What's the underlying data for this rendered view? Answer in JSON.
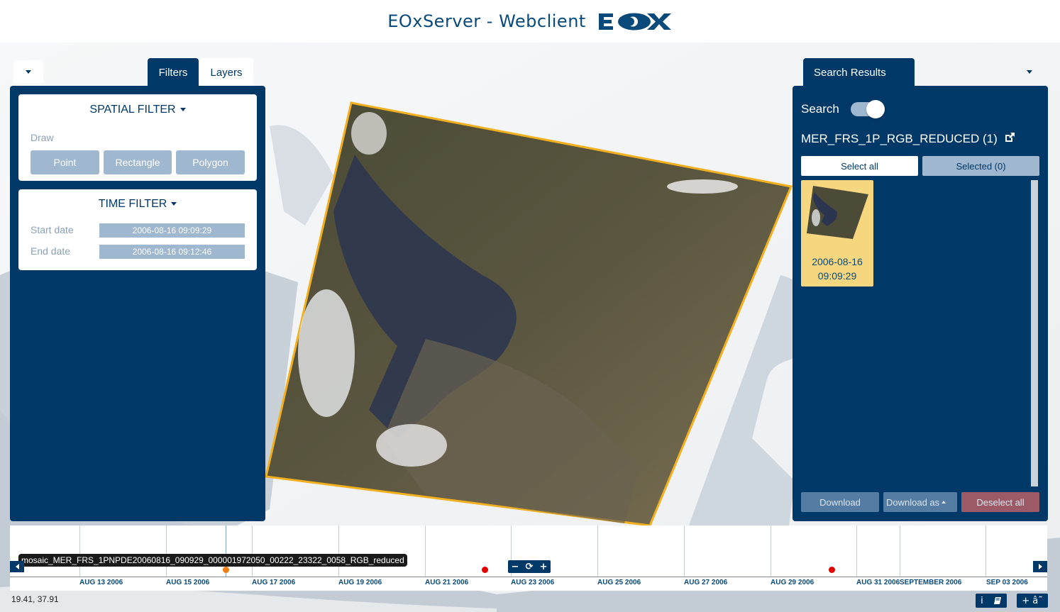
{
  "header": {
    "title": "EOxServer - Webclient",
    "logo_text": "EOX"
  },
  "left_panel": {
    "tabs": [
      {
        "label": "Filters",
        "active": true
      },
      {
        "label": "Layers",
        "active": false
      }
    ],
    "spatial_filter": {
      "title": "SPATIAL FILTER",
      "draw_label": "Draw",
      "buttons": [
        "Point",
        "Rectangle",
        "Polygon"
      ]
    },
    "time_filter": {
      "title": "TIME FILTER",
      "start_label": "Start date",
      "start_value": "2006-08-16 09:09:29",
      "end_label": "End date",
      "end_value": "2006-08-16 09:12:46"
    }
  },
  "right_panel": {
    "tab": "Search Results",
    "search_label": "Search",
    "search_enabled": true,
    "collection": "MER_FRS_1P_RGB_REDUCED (1)",
    "select_all": "Select all",
    "selected": "Selected (0)",
    "results": [
      {
        "date": "2006-08-16",
        "time": "09:09:29"
      }
    ],
    "download": "Download",
    "download_as": "Download as",
    "deselect_all": "Deselect all"
  },
  "timeline": {
    "tooltip": "mosaic_MER_FRS_1PNPDE20060816_090929_000001972050_00222_23322_0058_RGB_reduced",
    "labels": [
      "AUG 13 2006",
      "AUG 15 2006",
      "AUG 17 2006",
      "AUG 19 2006",
      "AUG 21 2006",
      "AUG 23 2006",
      "AUG 25 2006",
      "AUG 27 2006",
      "AUG 29 2006",
      "AUG 31 2006",
      "SEPTEMBER 2006",
      "SEP 03 2006"
    ],
    "zoom_controls": [
      "−",
      "⟳",
      "+"
    ]
  },
  "coordinates": "19.41, 37.91",
  "corner_buttons": {
    "info": "i",
    "book_icon": "book-icon",
    "misc": "+ â˜"
  },
  "colors": {
    "panel": "#003868",
    "footprint": "#f2b01e",
    "accent": "#0a4a7a",
    "marker": "#e00000",
    "selected_marker": "#f07d14"
  }
}
